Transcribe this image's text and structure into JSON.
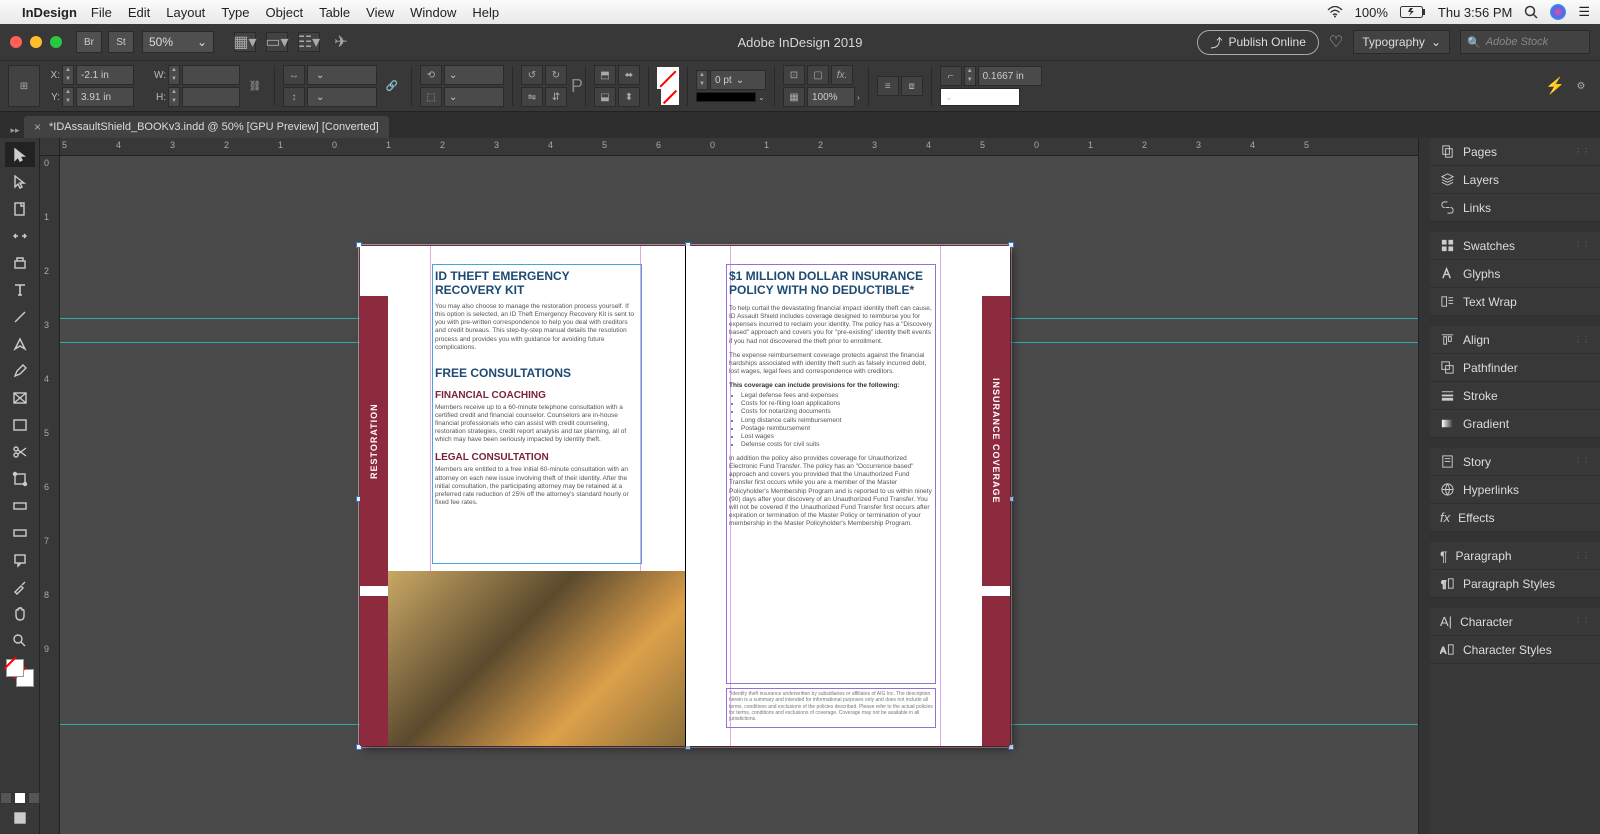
{
  "mac_menu": {
    "app_name": "InDesign",
    "items": [
      "File",
      "Edit",
      "Layout",
      "Type",
      "Object",
      "Table",
      "View",
      "Window",
      "Help"
    ],
    "battery": "100%",
    "clock": "Thu 3:56 PM"
  },
  "app_bar": {
    "bridge": "Br",
    "stock": "St",
    "zoom": "50%",
    "title": "Adobe InDesign 2019",
    "publish": "Publish Online",
    "workspace": "Typography",
    "search_placeholder": "Adobe Stock"
  },
  "control": {
    "x": "-2.1 in",
    "y": "3.91 in",
    "w": "",
    "h": "",
    "stroke_pt": "0 pt",
    "opacity": "100%",
    "frame_size": "0.1667 in"
  },
  "doc_tab": "*IDAssaultShield_BOOKv3.indd @ 50% [GPU Preview] [Converted]",
  "rulers": {
    "h": [
      "5",
      "4",
      "3",
      "2",
      "1",
      "0",
      "1",
      "2",
      "3",
      "4",
      "5",
      "6",
      "0",
      "1",
      "2",
      "3",
      "4",
      "5",
      "0",
      "1",
      "2",
      "3",
      "4",
      "5"
    ],
    "v": [
      "0",
      "1",
      "2",
      "3",
      "4",
      "5",
      "6",
      "7",
      "8",
      "9"
    ]
  },
  "doc": {
    "left_tab": "RESTORATION",
    "right_tab": "INSURANCE COVERAGE",
    "l_h1": "ID THEFT EMERGENCY RECOVERY KIT",
    "l_p1": "You may also choose to manage the restoration process yourself. If this option is selected, an ID Theft Emergency Recovery Kit is sent to you with pre-written correspondence to help you deal with creditors and credit bureaus. This step-by-step manual details the resolution process and provides you with guidance for avoiding future complications.",
    "l_h2": "FREE CONSULTATIONS",
    "l_sub1": "FINANCIAL COACHING",
    "l_p2": "Members receive up to a 60-minute telephone consultation with a certified credit and financial counselor. Counselors are in-house financial professionals who can assist with credit counseling, restoration strategies, credit report analysis and tax planning, all of which may have been seriously impacted by identity theft.",
    "l_sub2": "LEGAL CONSULTATION",
    "l_p3": "Members are entitled to a free initial 60-minute consultation with an attorney on each new issue involving theft of their identity. After the initial consultation, the participating attorney may be retained at a preferred rate reduction of 25% off the attorney's standard hourly or fixed fee rates.",
    "r_h1a": "$1 MILLION DOLLAR INSURANCE",
    "r_h1b": "POLICY WITH NO DEDUCTIBLE*",
    "r_p1": "To help curtail the devastating financial impact identity theft can cause, ID Assault Shield includes coverage designed to reimburse you for expenses incurred to reclaim your identity. The policy has a \"Discovery based\" approach and covers you for \"pre-existing\" identity theft events if you had not discovered the theft prior to enrollment.",
    "r_p2": "The expense reimbursement coverage protects against the financial hardships associated with identity theft such as falsely incurred debt, lost wages, legal fees and correspondence with creditors.",
    "r_bold": "This coverage can include provisions for the following:",
    "r_bullets": [
      "Legal defense fees and expenses",
      "Costs for re-filing loan applications",
      "Costs for notarizing documents",
      "Long distance calls reimbursement",
      "Postage reimbursement",
      "Lost wages",
      "Defense costs for civil suits"
    ],
    "r_p3": "In addition the policy also provides coverage for Unauthorized Electronic Fund Transfer. The policy has an \"Occurrence based\" approach and covers you provided that the Unauthorized Fund Transfer first occurs while you are a member of the Master Policyholder's Membership Program and is reported to us within ninety (90) days after your discovery of an Unauthorized Fund Transfer. You will not be covered if the Unauthorized Fund Transfer first occurs after expiration or termination of the Master Policy or termination of your membership in the Master Policyholder's Membership Program.",
    "r_foot": "*Identity theft insurance underwritten by subsidiaries or affiliates of AIG Inc. The description herein is a summary and intended for informational purposes only and does not include all terms, conditions and exclusions of the policies described. Please refer to the actual policies for terms, conditions and exclusions of coverage. Coverage may not be available in all jurisdictions."
  },
  "panels": [
    "Pages",
    "Layers",
    "Links",
    "Swatches",
    "Glyphs",
    "Text Wrap",
    "Align",
    "Pathfinder",
    "Stroke",
    "Gradient",
    "Story",
    "Hyperlinks",
    "Effects",
    "Paragraph",
    "Paragraph Styles",
    "Character",
    "Character Styles"
  ]
}
